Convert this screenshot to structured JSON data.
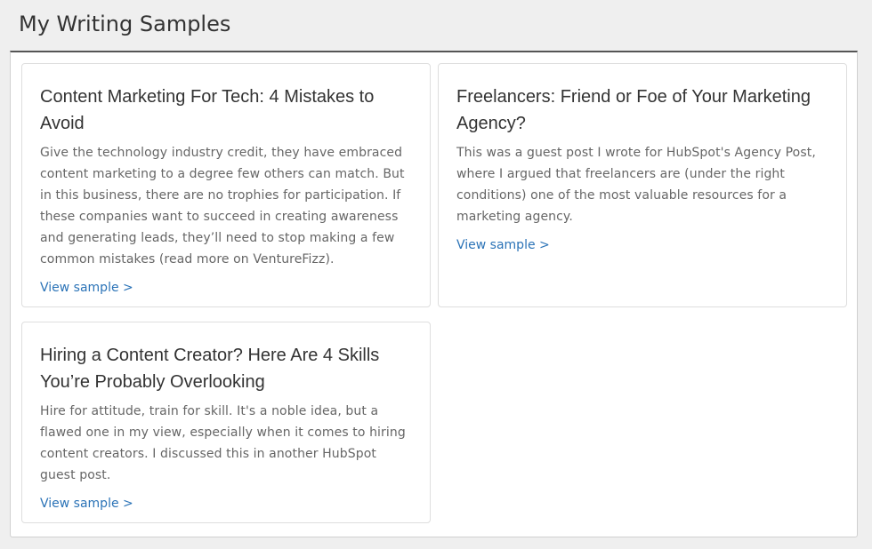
{
  "page": {
    "title": "My Writing Samples"
  },
  "samples": [
    {
      "title": "Content Marketing For Tech: 4 Mistakes to Avoid",
      "description": "Give the technology industry credit, they have embraced content marketing to a degree few others can match. But in this business, there are no trophies for participation. If these companies want to succeed in creating awareness and generating leads, they’ll need to stop making a few common mistakes (read more on VentureFizz).",
      "link_label": "View sample >"
    },
    {
      "title": "Freelancers: Friend or Foe of Your Marketing Agency?",
      "description": "This was a guest post I wrote for HubSpot's Agency Post, where I argued that freelancers are (under the right conditions) one of the most valuable resources for a marketing agency.",
      "link_label": "View sample >"
    },
    {
      "title": "Hiring a Content Creator? Here Are 4 Skills You’re Probably Overlooking",
      "description": "Hire for attitude, train for skill. It's a noble idea, but a flawed one in my view, especially when it comes to hiring content creators. I discussed this in another HubSpot guest post.",
      "link_label": "View sample >"
    }
  ],
  "colors": {
    "background": "#efefef",
    "card": "#ffffff",
    "link": "#2b73b7",
    "title_text": "#333333",
    "body_text": "#666666"
  }
}
